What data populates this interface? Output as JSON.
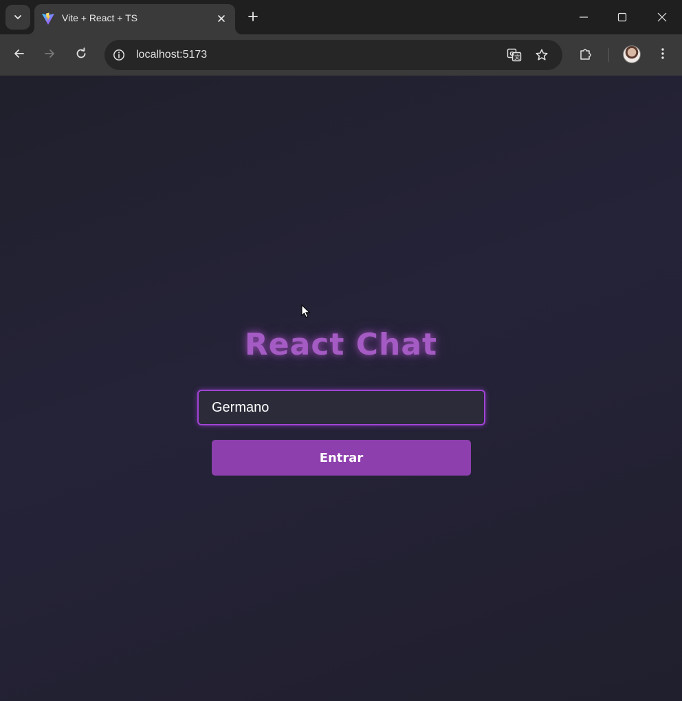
{
  "browser": {
    "tab": {
      "title": "Vite + React + TS",
      "favicon": "vite-icon"
    },
    "omnibox": {
      "url": "localhost:5173"
    },
    "icons": {
      "tab_search": "chevron-down-icon",
      "tab_close": "close-icon",
      "new_tab": "plus-icon",
      "back": "arrow-left-icon",
      "forward": "arrow-right-icon",
      "reload": "reload-icon",
      "site_info": "info-icon",
      "translate": "translate-icon",
      "bookmark": "star-icon",
      "extensions": "puzzle-icon",
      "menu": "kebab-menu-icon"
    }
  },
  "page": {
    "title": "React Chat",
    "username_input": {
      "value": "Germano"
    },
    "enter_button": {
      "label": "Entrar"
    }
  },
  "colors": {
    "accent": "#a55bc4",
    "button": "#8e3fae",
    "input_border": "#a243d6",
    "background": "#222233"
  }
}
